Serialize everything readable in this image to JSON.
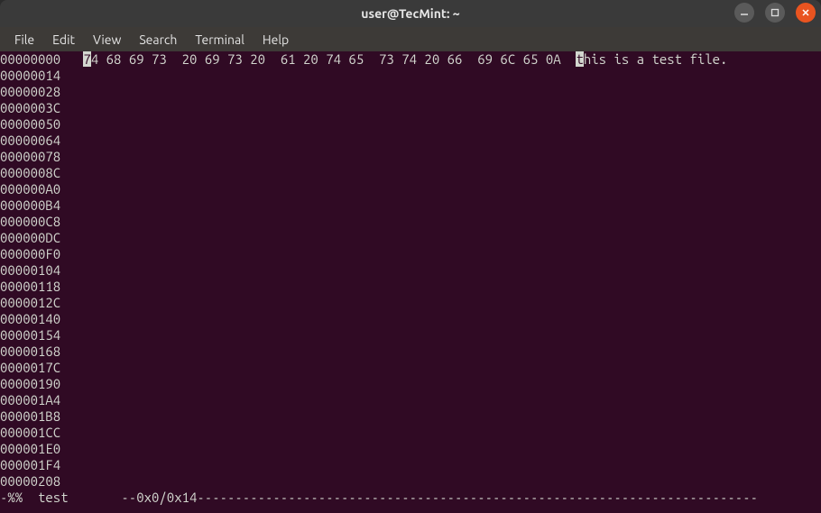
{
  "titlebar": {
    "title": "user@TecMint: ~"
  },
  "menubar": {
    "file": "File",
    "edit": "Edit",
    "view": "View",
    "search": "Search",
    "terminal": "Terminal",
    "help": "Help"
  },
  "hex": {
    "offsets": [
      "00000000",
      "00000014",
      "00000028",
      "0000003C",
      "00000050",
      "00000064",
      "00000078",
      "0000008C",
      "000000A0",
      "000000B4",
      "000000C8",
      "000000DC",
      "000000F0",
      "00000104",
      "00000118",
      "0000012C",
      "00000140",
      "00000154",
      "00000168",
      "0000017C",
      "00000190",
      "000001A4",
      "000001B8",
      "000001CC",
      "000001E0",
      "000001F4",
      "00000208"
    ],
    "first_byte_cursor": "7",
    "first_byte_rest": "4",
    "bytes_rest": " 68 69 73  20 69 73 20  61 20 74 65  73 74 20 66  69 6C 65 0A  ",
    "ascii_cursor": "t",
    "ascii_rest": "his is a test file."
  },
  "status": {
    "text": "-%%  test       --0x0/0x14--------------------------------------------------------------------------"
  }
}
